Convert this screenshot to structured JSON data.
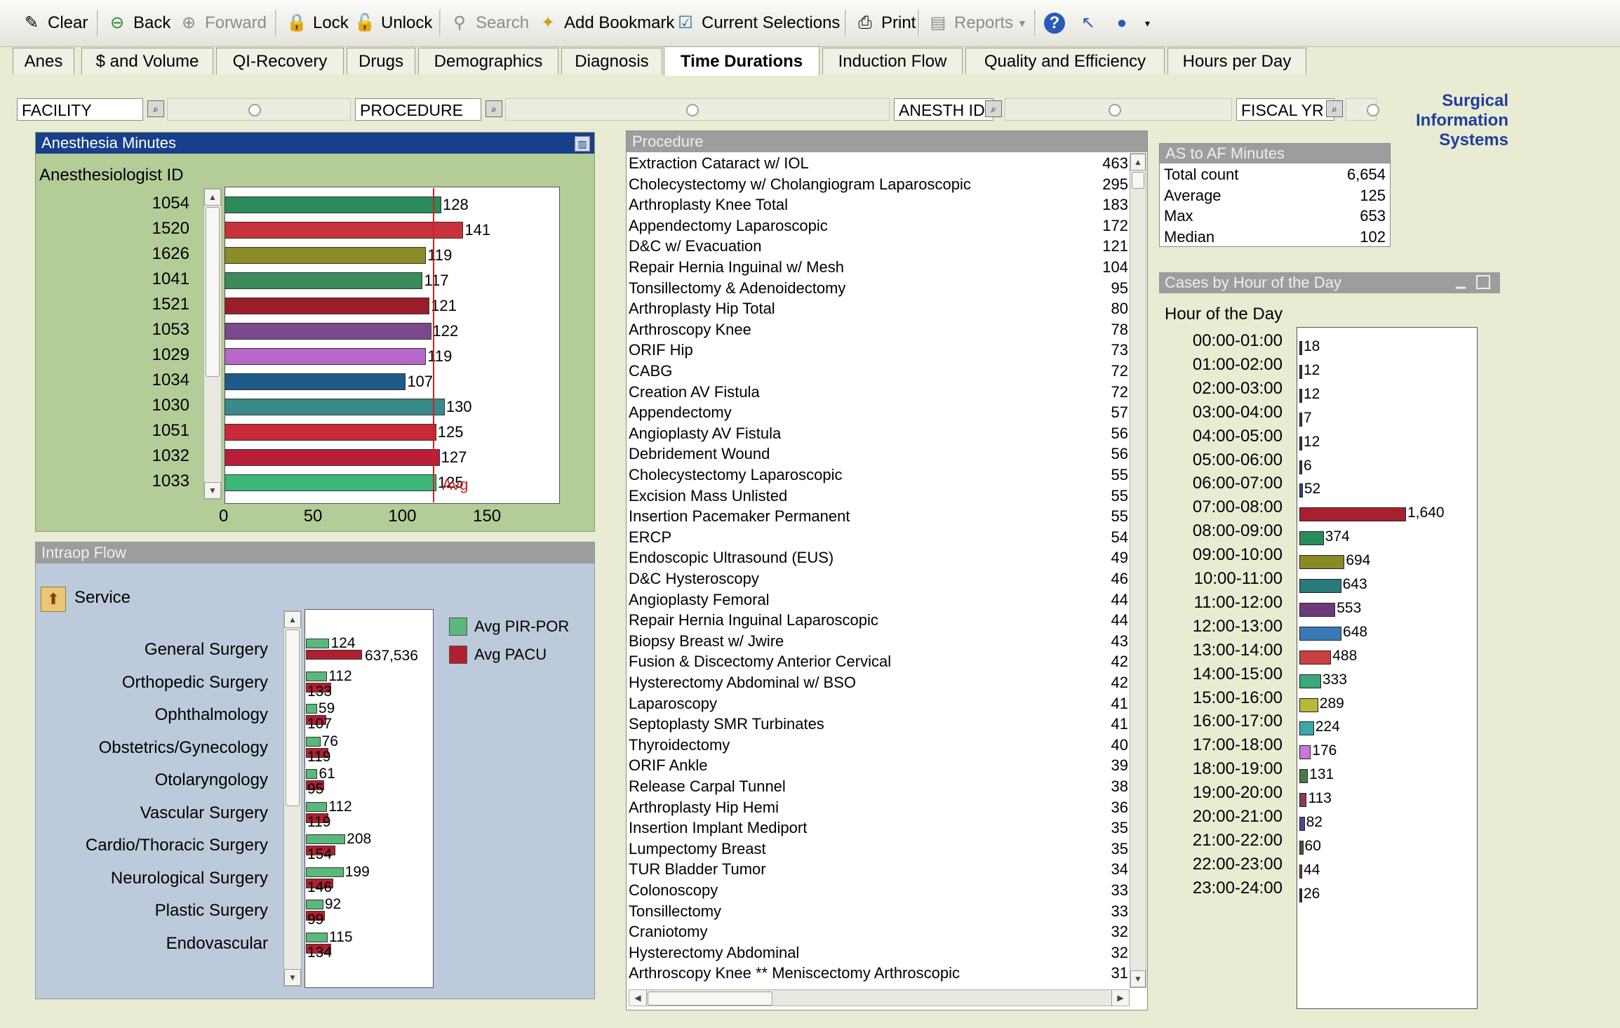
{
  "toolbar": {
    "clear": "Clear",
    "back": "Back",
    "forward": "Forward",
    "lock": "Lock",
    "unlock": "Unlock",
    "search": "Search",
    "add_bookmark": "Add Bookmark",
    "current_selections": "Current Selections",
    "print": "Print",
    "reports": "Reports"
  },
  "tabs": [
    "Anes",
    "$ and Volume",
    "QI-Recovery",
    "Drugs",
    "Demographics",
    "Diagnosis",
    "Time Durations",
    "Induction Flow",
    "Quality and Efficiency",
    "Hours per Day"
  ],
  "active_tab": "Time Durations",
  "selections": {
    "facility": "FACILITY",
    "procedure": "PROCEDURE",
    "anesth_id": "ANESTH ID",
    "fiscal_yr": "FISCAL YR"
  },
  "brand": {
    "line1": "Surgical",
    "line2": "Information",
    "line3": "Systems"
  },
  "anesthesia": {
    "title": "Anesthesia Minutes",
    "dimension_label": "Anesthesiologist ID",
    "avg_label": "Avg",
    "chart_data": {
      "type": "bar",
      "orientation": "horizontal",
      "categories": [
        "1054",
        "1520",
        "1626",
        "1041",
        "1521",
        "1053",
        "1029",
        "1034",
        "1030",
        "1051",
        "1032",
        "1033"
      ],
      "values": [
        128,
        141,
        119,
        117,
        121,
        122,
        119,
        107,
        130,
        125,
        127,
        125
      ],
      "colors": [
        "#2a8a5a",
        "#c8323a",
        "#8c8c28",
        "#3a8a5a",
        "#9a1e2a",
        "#7a4a8a",
        "#b868c8",
        "#1e5a8a",
        "#3a8a8a",
        "#c82a3a",
        "#b81e3a",
        "#3ab87a"
      ],
      "average": 124,
      "x_ticks": [
        "0",
        "50",
        "100",
        "150"
      ],
      "xlim": [
        0,
        198
      ]
    }
  },
  "procedure": {
    "title": "Procedure",
    "rows": [
      {
        "name": "Extraction Cataract w/ IOL",
        "count": "463"
      },
      {
        "name": "Cholecystectomy w/ Cholangiogram Laparoscopic",
        "count": "295"
      },
      {
        "name": "Arthroplasty Knee Total",
        "count": "183"
      },
      {
        "name": "Appendectomy Laparoscopic",
        "count": "172"
      },
      {
        "name": "D&C w/ Evacuation",
        "count": "121"
      },
      {
        "name": "Repair Hernia Inguinal w/ Mesh",
        "count": "104"
      },
      {
        "name": "Tonsillectomy & Adenoidectomy",
        "count": "95"
      },
      {
        "name": "Arthroplasty Hip Total",
        "count": "80"
      },
      {
        "name": "Arthroscopy Knee",
        "count": "78"
      },
      {
        "name": "ORIF Hip",
        "count": "73"
      },
      {
        "name": "CABG",
        "count": "72"
      },
      {
        "name": "Creation AV Fistula",
        "count": "72"
      },
      {
        "name": "Appendectomy",
        "count": "57"
      },
      {
        "name": "Angioplasty AV Fistula",
        "count": "56"
      },
      {
        "name": "Debridement Wound",
        "count": "56"
      },
      {
        "name": "Cholecystectomy Laparoscopic",
        "count": "55"
      },
      {
        "name": "Excision Mass Unlisted",
        "count": "55"
      },
      {
        "name": "Insertion Pacemaker Permanent",
        "count": "55"
      },
      {
        "name": "ERCP",
        "count": "54"
      },
      {
        "name": "Endoscopic Ultrasound (EUS)",
        "count": "49"
      },
      {
        "name": "D&C Hysteroscopy",
        "count": "46"
      },
      {
        "name": "Angioplasty Femoral",
        "count": "44"
      },
      {
        "name": "Repair Hernia Inguinal Laparoscopic",
        "count": "44"
      },
      {
        "name": "Biopsy Breast w/ Jwire",
        "count": "43"
      },
      {
        "name": "Fusion & Discectomy Anterior Cervical",
        "count": "42"
      },
      {
        "name": "Hysterectomy Abdominal  w/ BSO",
        "count": "42"
      },
      {
        "name": "Laparoscopy",
        "count": "41"
      },
      {
        "name": "Septoplasty SMR Turbinates",
        "count": "41"
      },
      {
        "name": "Thyroidectomy",
        "count": "40"
      },
      {
        "name": "ORIF Ankle",
        "count": "39"
      },
      {
        "name": "Release Carpal Tunnel",
        "count": "38"
      },
      {
        "name": "Arthroplasty Hip Hemi",
        "count": "36"
      },
      {
        "name": "Insertion Implant Mediport",
        "count": "35"
      },
      {
        "name": "Lumpectomy Breast",
        "count": "35"
      },
      {
        "name": "TUR Bladder Tumor",
        "count": "34"
      },
      {
        "name": "Colonoscopy",
        "count": "33"
      },
      {
        "name": "Tonsillectomy",
        "count": "33"
      },
      {
        "name": "Craniotomy",
        "count": "32"
      },
      {
        "name": "Hysterectomy Abdominal",
        "count": "32"
      },
      {
        "name": "Arthroscopy Knee ** Meniscectomy Arthroscopic",
        "count": "31"
      }
    ]
  },
  "as_af": {
    "title": "AS to AF Minutes",
    "rows": [
      {
        "label": "Total count",
        "value": "6,654"
      },
      {
        "label": "Average",
        "value": "125"
      },
      {
        "label": "Max",
        "value": "653"
      },
      {
        "label": "Median",
        "value": "102"
      }
    ]
  },
  "cases_by_hour": {
    "title": "Cases by Hour of the Day",
    "dimension_label": "Hour of the Day",
    "chart_data": {
      "type": "bar",
      "orientation": "horizontal",
      "categories": [
        "00:00-01:00",
        "01:00-02:00",
        "02:00-03:00",
        "03:00-04:00",
        "04:00-05:00",
        "05:00-06:00",
        "06:00-07:00",
        "07:00-08:00",
        "08:00-09:00",
        "09:00-10:00",
        "10:00-11:00",
        "11:00-12:00",
        "12:00-13:00",
        "13:00-14:00",
        "14:00-15:00",
        "15:00-16:00",
        "16:00-17:00",
        "17:00-18:00",
        "18:00-19:00",
        "19:00-20:00",
        "20:00-21:00",
        "21:00-22:00",
        "22:00-23:00",
        "23:00-24:00"
      ],
      "values": [
        18,
        12,
        12,
        7,
        12,
        6,
        52,
        1640,
        374,
        694,
        643,
        553,
        648,
        488,
        333,
        289,
        224,
        176,
        131,
        113,
        82,
        60,
        44,
        26
      ],
      "labels": [
        "18",
        "12",
        "12",
        "7",
        "12",
        "6",
        "52",
        "1,640",
        "374",
        "694",
        "643",
        "553",
        "648",
        "488",
        "333",
        "289",
        "224",
        "176",
        "131",
        "113",
        "82",
        "60",
        "44",
        "26"
      ],
      "colors": [
        "#3a2a6a",
        "#2a3a5a",
        "#2a3a5a",
        "#2a3a5a",
        "#2a3a5a",
        "#2a3a5a",
        "#2a4a7a",
        "#a82030",
        "#2a8a5a",
        "#8a8a28",
        "#2a7a7a",
        "#6a3a7a",
        "#3a78b8",
        "#c84040",
        "#3aa87a",
        "#b8b838",
        "#3aa8a8",
        "#c878d8",
        "#4a7a4a",
        "#8a3a5a",
        "#4a4a8a",
        "#3a5a3a",
        "#6a3a4a",
        "#2a2a6a"
      ],
      "xlim": [
        0,
        1640
      ]
    }
  },
  "intraop": {
    "title": "Intraop Flow",
    "dimension_label": "Service",
    "chart_data": {
      "type": "bar",
      "orientation": "horizontal",
      "categories": [
        "General Surgery",
        "Orthopedic Surgery",
        "Ophthalmology",
        "Obstetrics/Gynecology",
        "Otolaryngology",
        "Vascular Surgery",
        "Cardio/Thoracic Surgery",
        "Neurological Surgery",
        "Plastic Surgery",
        "Endovascular"
      ],
      "series": [
        {
          "name": "Avg PIR-POR",
          "color": "#5ab87a",
          "values": [
            124,
            112,
            59,
            76,
            61,
            112,
            208,
            199,
            92,
            115
          ],
          "labels": [
            "124",
            "112",
            "59",
            "76",
            "61",
            "112",
            "208",
            "199",
            "92",
            "115"
          ]
        },
        {
          "name": "Avg PACU",
          "color": "#b02030",
          "values": [
            637536,
            133,
            107,
            119,
            95,
            119,
            154,
            146,
            99,
            134
          ],
          "labels": [
            "637,536",
            "133",
            "107",
            "119",
            "95",
            "119",
            "154",
            "146",
            "99",
            "134"
          ]
        }
      ]
    }
  }
}
